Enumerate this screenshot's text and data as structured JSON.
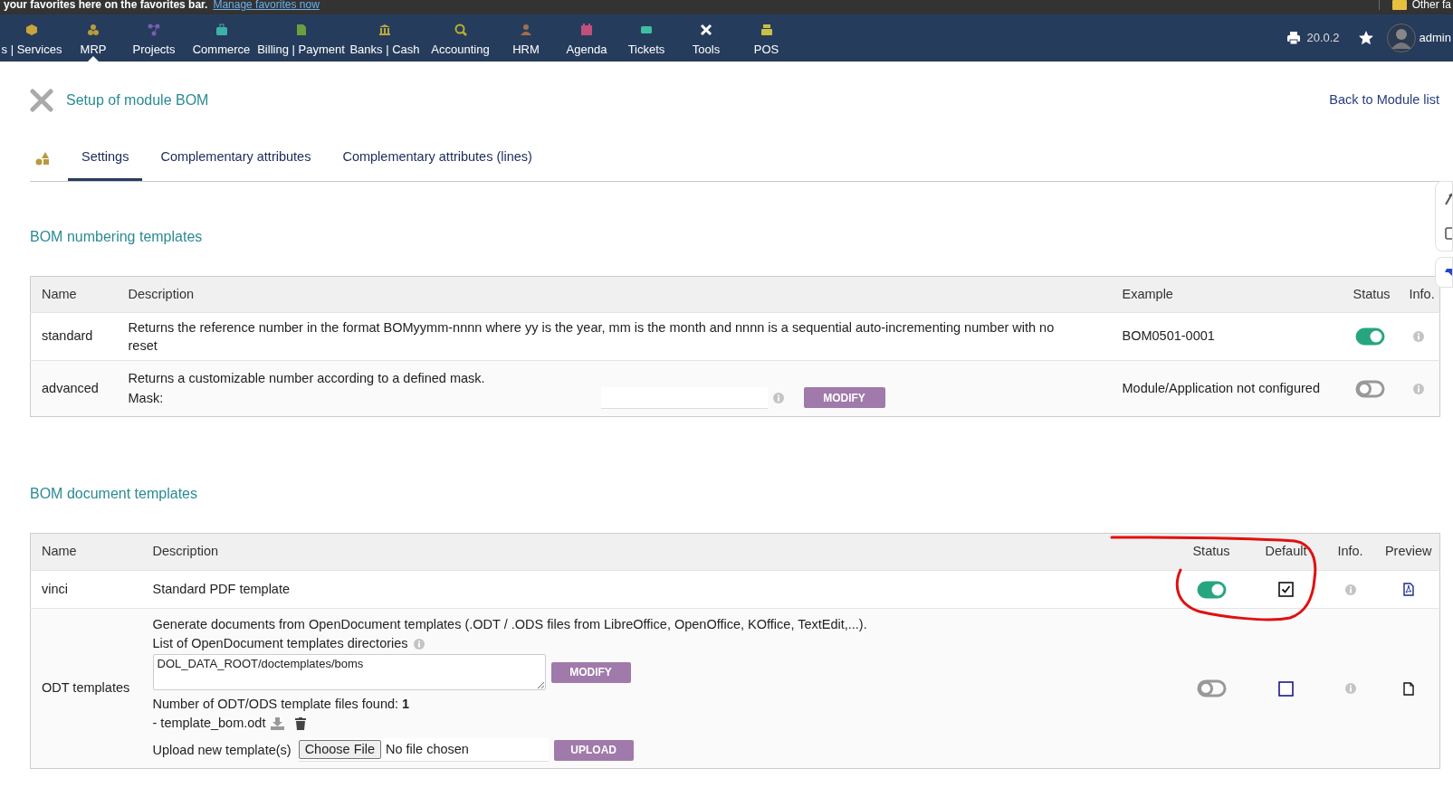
{
  "favorites_bar": {
    "message": "your favorites here on the favorites bar.",
    "link": "Manage favorites now",
    "folder": "Other fa"
  },
  "top_menu": {
    "items": [
      {
        "label": "s | Services",
        "selected": false,
        "color": "#c9a43c"
      },
      {
        "label": "MRP",
        "selected": true,
        "color": "#b89a3c"
      },
      {
        "label": "Projects",
        "selected": false,
        "color": "#7a5cb0"
      },
      {
        "label": "Commerce",
        "selected": false,
        "color": "#3fb0a7"
      },
      {
        "label": "Billing | Payment",
        "selected": false,
        "color": "#6a9e3f"
      },
      {
        "label": "Banks | Cash",
        "selected": false,
        "color": "#b8a83a"
      },
      {
        "label": "Accounting",
        "selected": false,
        "color": "#b8b02a"
      },
      {
        "label": "HRM",
        "selected": false,
        "color": "#a0704a"
      },
      {
        "label": "Agenda",
        "selected": false,
        "color": "#c0507a"
      },
      {
        "label": "Tickets",
        "selected": false,
        "color": "#3fbfa0"
      },
      {
        "label": "Tools",
        "selected": false,
        "color": "#ffffff"
      },
      {
        "label": "POS",
        "selected": false,
        "color": "#c8c040"
      }
    ],
    "version": "20.0.2",
    "user": "admin"
  },
  "page": {
    "title": "Setup of module BOM",
    "back_link": "Back to Module list"
  },
  "tabs": [
    {
      "label": "Settings",
      "selected": true
    },
    {
      "label": "Complementary attributes",
      "selected": false
    },
    {
      "label": "Complementary attributes (lines)",
      "selected": false
    }
  ],
  "numbering": {
    "heading": "BOM numbering templates",
    "columns": [
      "Name",
      "Description",
      "Example",
      "Status",
      "Info."
    ],
    "rows": [
      {
        "kind": "simple",
        "name": "standard",
        "description": "Returns the reference number in the format BOMyymm-nnnn where yy is the year, mm is the month and nnnn is a sequential auto-incrementing number with no reset",
        "example": "BOM0501-0001",
        "on": true
      },
      {
        "kind": "mask",
        "name": "advanced",
        "description": "Returns a customizable number according to a defined mask.",
        "mask_label": "Mask:",
        "button": "MODIFY",
        "example": "Module/Application not configured",
        "on": false
      }
    ]
  },
  "documents": {
    "heading": "BOM document templates",
    "columns": [
      "Name",
      "Description",
      "Status",
      "Default",
      "Info.",
      "Preview"
    ],
    "rows": [
      {
        "kind": "simple",
        "name": "vinci",
        "description": "Standard PDF template",
        "on": true,
        "default": true,
        "preview": {
          "kind": "pdf"
        }
      },
      {
        "kind": "odt",
        "name": "ODT templates",
        "description": "Generate documents from OpenDocument templates (.ODT / .ODS files from LibreOffice, OpenOffice, KOffice, TextEdit,...).",
        "dirs_label": "List of OpenDocument templates directories",
        "dirs_value": "DOL_DATA_ROOT/doctemplates/boms",
        "modify_button": "MODIFY",
        "found_label": "Number of ODT/ODS template files found: **1**",
        "file": "- template_bom.odt",
        "upload_label": "Upload new template(s)",
        "choose_button": "Choose File",
        "no_file": "No file chosen",
        "upload_button": "UPLOAD",
        "on": false,
        "default": false,
        "preview": {
          "kind": "file"
        }
      }
    ]
  },
  "annotation": {
    "kind": "freehand_loop"
  }
}
